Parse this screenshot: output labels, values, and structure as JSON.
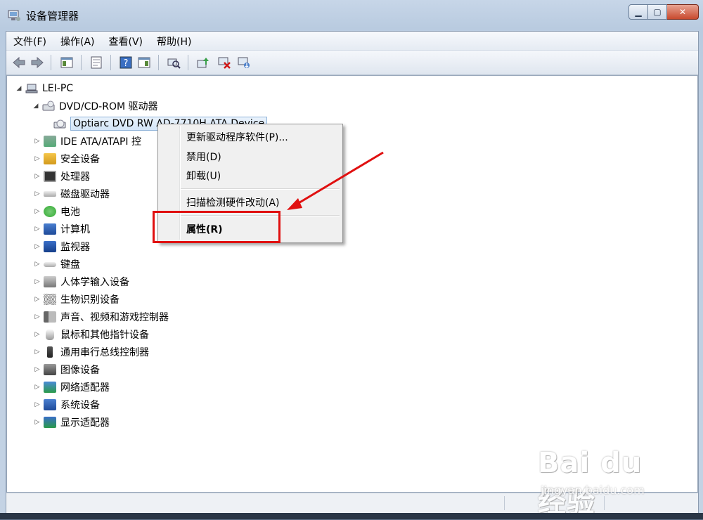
{
  "window": {
    "title": "设备管理器"
  },
  "menu": [
    "文件(F)",
    "操作(A)",
    "查看(V)",
    "帮助(H)"
  ],
  "toolbar_icons": [
    "back-icon",
    "forward-icon",
    "show-hide-tree-icon",
    "properties-icon",
    "help-icon",
    "view-icon",
    "scan-icon",
    "update-driver-icon",
    "disable-icon",
    "uninstall-icon"
  ],
  "tree": {
    "root": "LEI-PC",
    "dvd_category": "DVD/CD-ROM 驱动器",
    "dvd_device": "Optiarc DVD RW AD-7710H ATA Device",
    "categories": [
      "IDE ATA/ATAPI 控",
      "安全设备",
      "处理器",
      "磁盘驱动器",
      "电池",
      "计算机",
      "监视器",
      "键盘",
      "人体学输入设备",
      "生物识别设备",
      "声音、视频和游戏控制器",
      "鼠标和其他指针设备",
      "通用串行总线控制器",
      "图像设备",
      "网络适配器",
      "系统设备",
      "显示适配器"
    ]
  },
  "context_menu": {
    "update_driver": "更新驱动程序软件(P)...",
    "disable": "禁用(D)",
    "uninstall": "卸载(U)",
    "scan": "扫描检测硬件改动(A)",
    "properties": "属性(R)"
  },
  "watermark": {
    "logo": "Bai du 经验",
    "url": "jingyan.baidu.com"
  },
  "colors": {
    "highlight": "#e01010",
    "selection": "#d3e5f8"
  }
}
